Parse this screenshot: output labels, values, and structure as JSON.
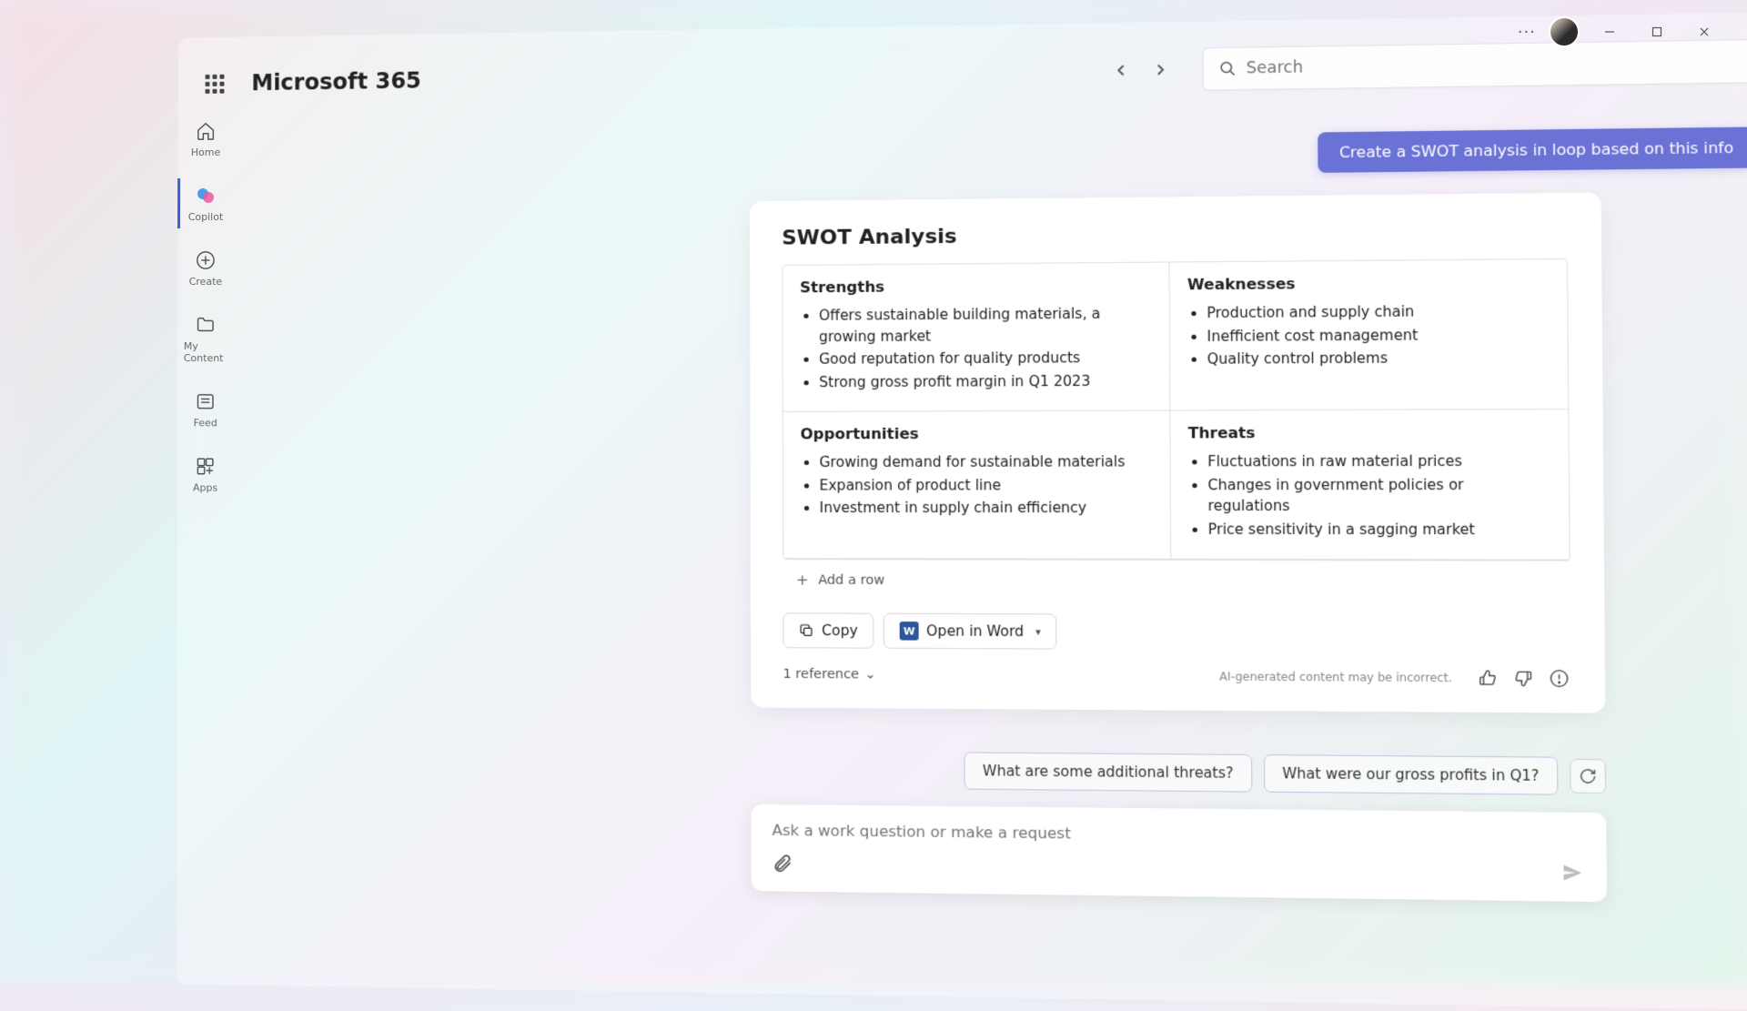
{
  "brand": "Microsoft 365",
  "search": {
    "placeholder": "Search"
  },
  "titlebar": {
    "more": "···"
  },
  "sidebar": {
    "items": [
      {
        "label": "Home"
      },
      {
        "label": "Copilot"
      },
      {
        "label": "Create"
      },
      {
        "label": "My Content"
      },
      {
        "label": "Feed"
      },
      {
        "label": "Apps"
      }
    ]
  },
  "chat": {
    "user_message": "Create a SWOT analysis in loop based on this info",
    "card_title": "SWOT Analysis",
    "swot": {
      "strengths": {
        "title": "Strengths",
        "items": [
          "Offers sustainable building materials, a growing market",
          "Good reputation for quality products",
          "Strong gross profit margin in Q1 2023"
        ]
      },
      "weaknesses": {
        "title": "Weaknesses",
        "items": [
          "Production and supply chain",
          "Inefficient cost management",
          "Quality control problems"
        ]
      },
      "opportunities": {
        "title": "Opportunities",
        "items": [
          "Growing demand for sustainable materials",
          "Expansion of product line",
          "Investment in supply chain efficiency"
        ]
      },
      "threats": {
        "title": "Threats",
        "items": [
          "Fluctuations in raw material prices",
          "Changes in government policies or regulations",
          "Price sensitivity in a sagging market"
        ]
      }
    },
    "add_row": "Add a row",
    "copy": "Copy",
    "open_word": "Open in Word",
    "references": "1 reference",
    "disclaimer": "AI-generated content may be incorrect.",
    "suggestions": [
      "What are some additional threats?",
      "What were our gross profits in Q1?"
    ],
    "composer_placeholder": "Ask a work question or make a request"
  }
}
